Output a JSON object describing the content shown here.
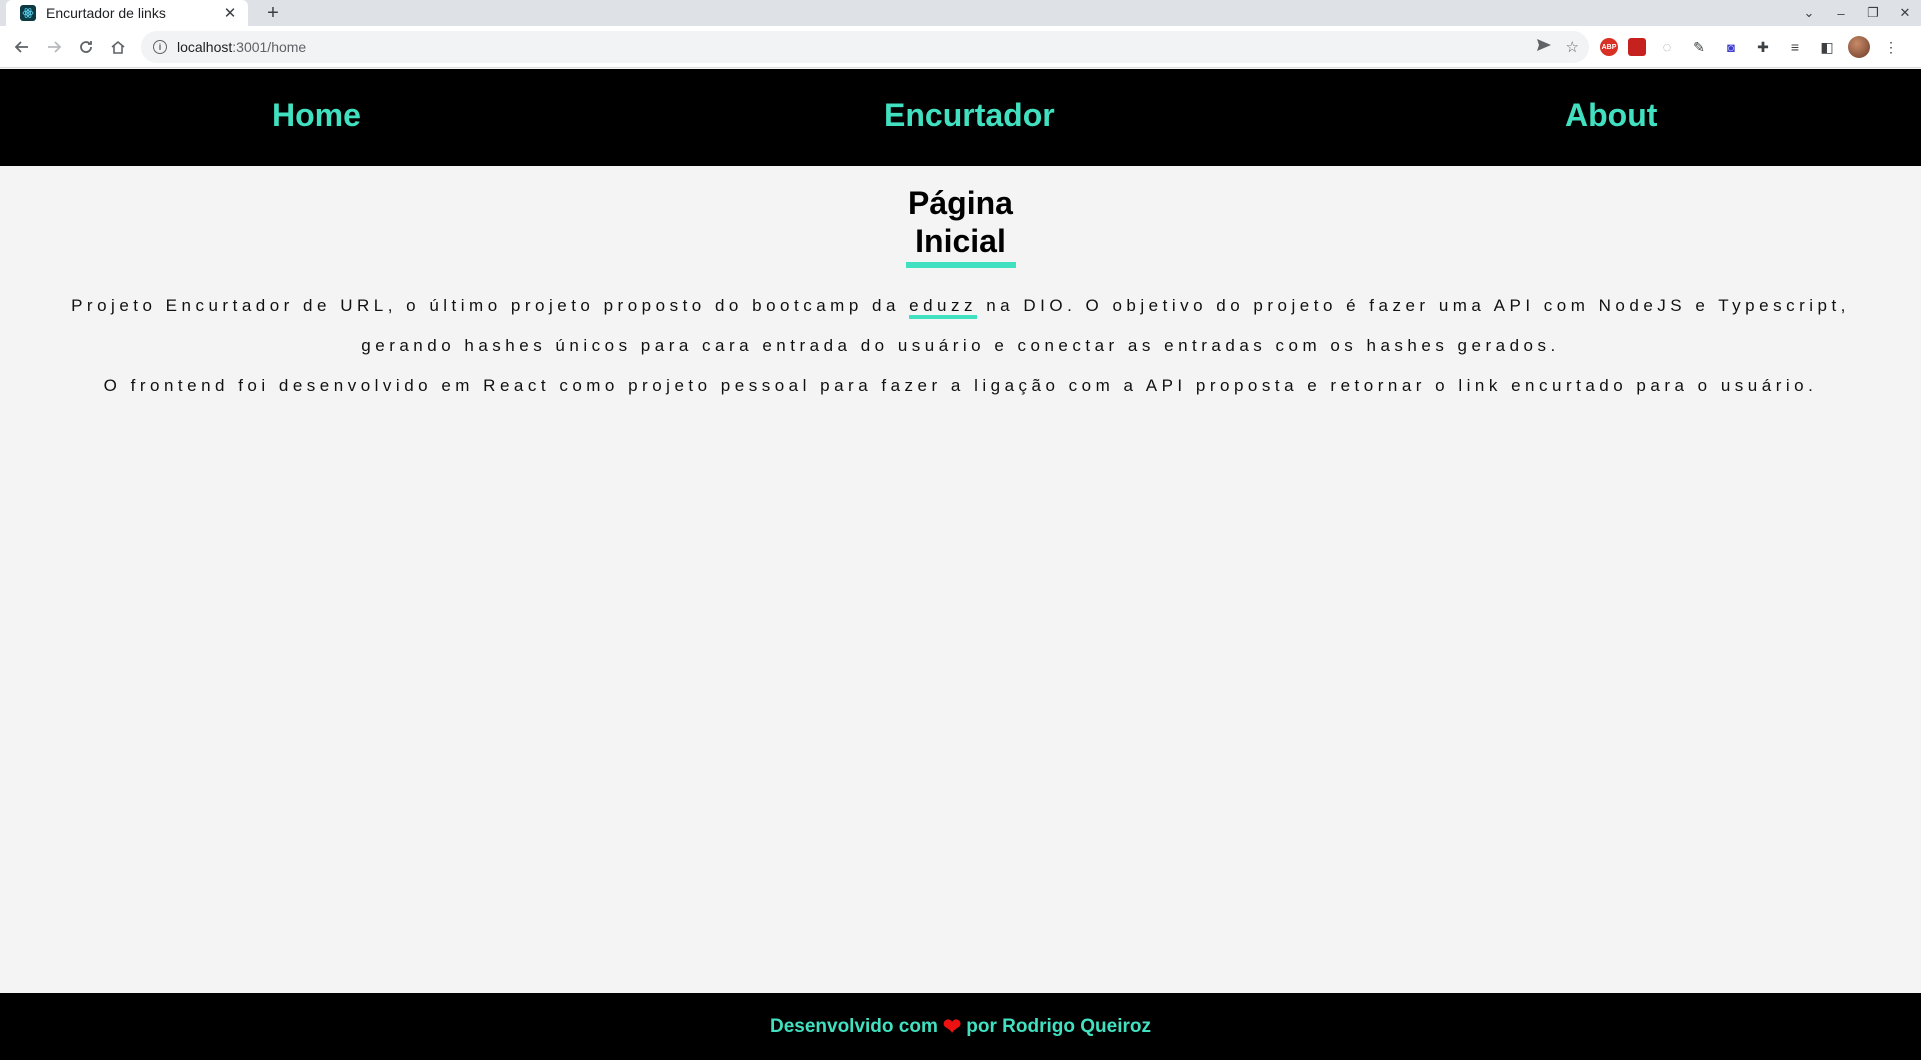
{
  "browser": {
    "tab_title": "Encurtador de links",
    "tab_close": "✕",
    "new_tab": "+",
    "url_host": "localhost",
    "url_path": ":3001/home",
    "window_minimize": "–",
    "window_restore": "❐",
    "window_close": "✕",
    "tab_menu": "⌄"
  },
  "nav": {
    "home": "Home",
    "encurtador": "Encurtador",
    "about": "About"
  },
  "main": {
    "title": "Página Inicial",
    "p1_before": "Projeto Encurtador de URL, o último projeto proposto do bootcamp da ",
    "p1_link": "eduzz",
    "p1_after": " na DIO. O objetivo do projeto é fazer uma API com NodeJS e Typescript, gerando hashes únicos para cara entrada do usuário e conectar as entradas com os hashes gerados.",
    "p2": "O frontend foi desenvolvido em React como projeto pessoal para fazer a ligação com a API proposta e retornar o link encurtado para o usuário."
  },
  "footer": {
    "before": "Desenvolvido com",
    "heart": "❤",
    "after": "por Rodrigo Queiroz"
  },
  "colors": {
    "accent": "#40e0c0",
    "header_bg": "#000000",
    "page_bg": "#f4f4f4",
    "heart": "#ee1111"
  }
}
